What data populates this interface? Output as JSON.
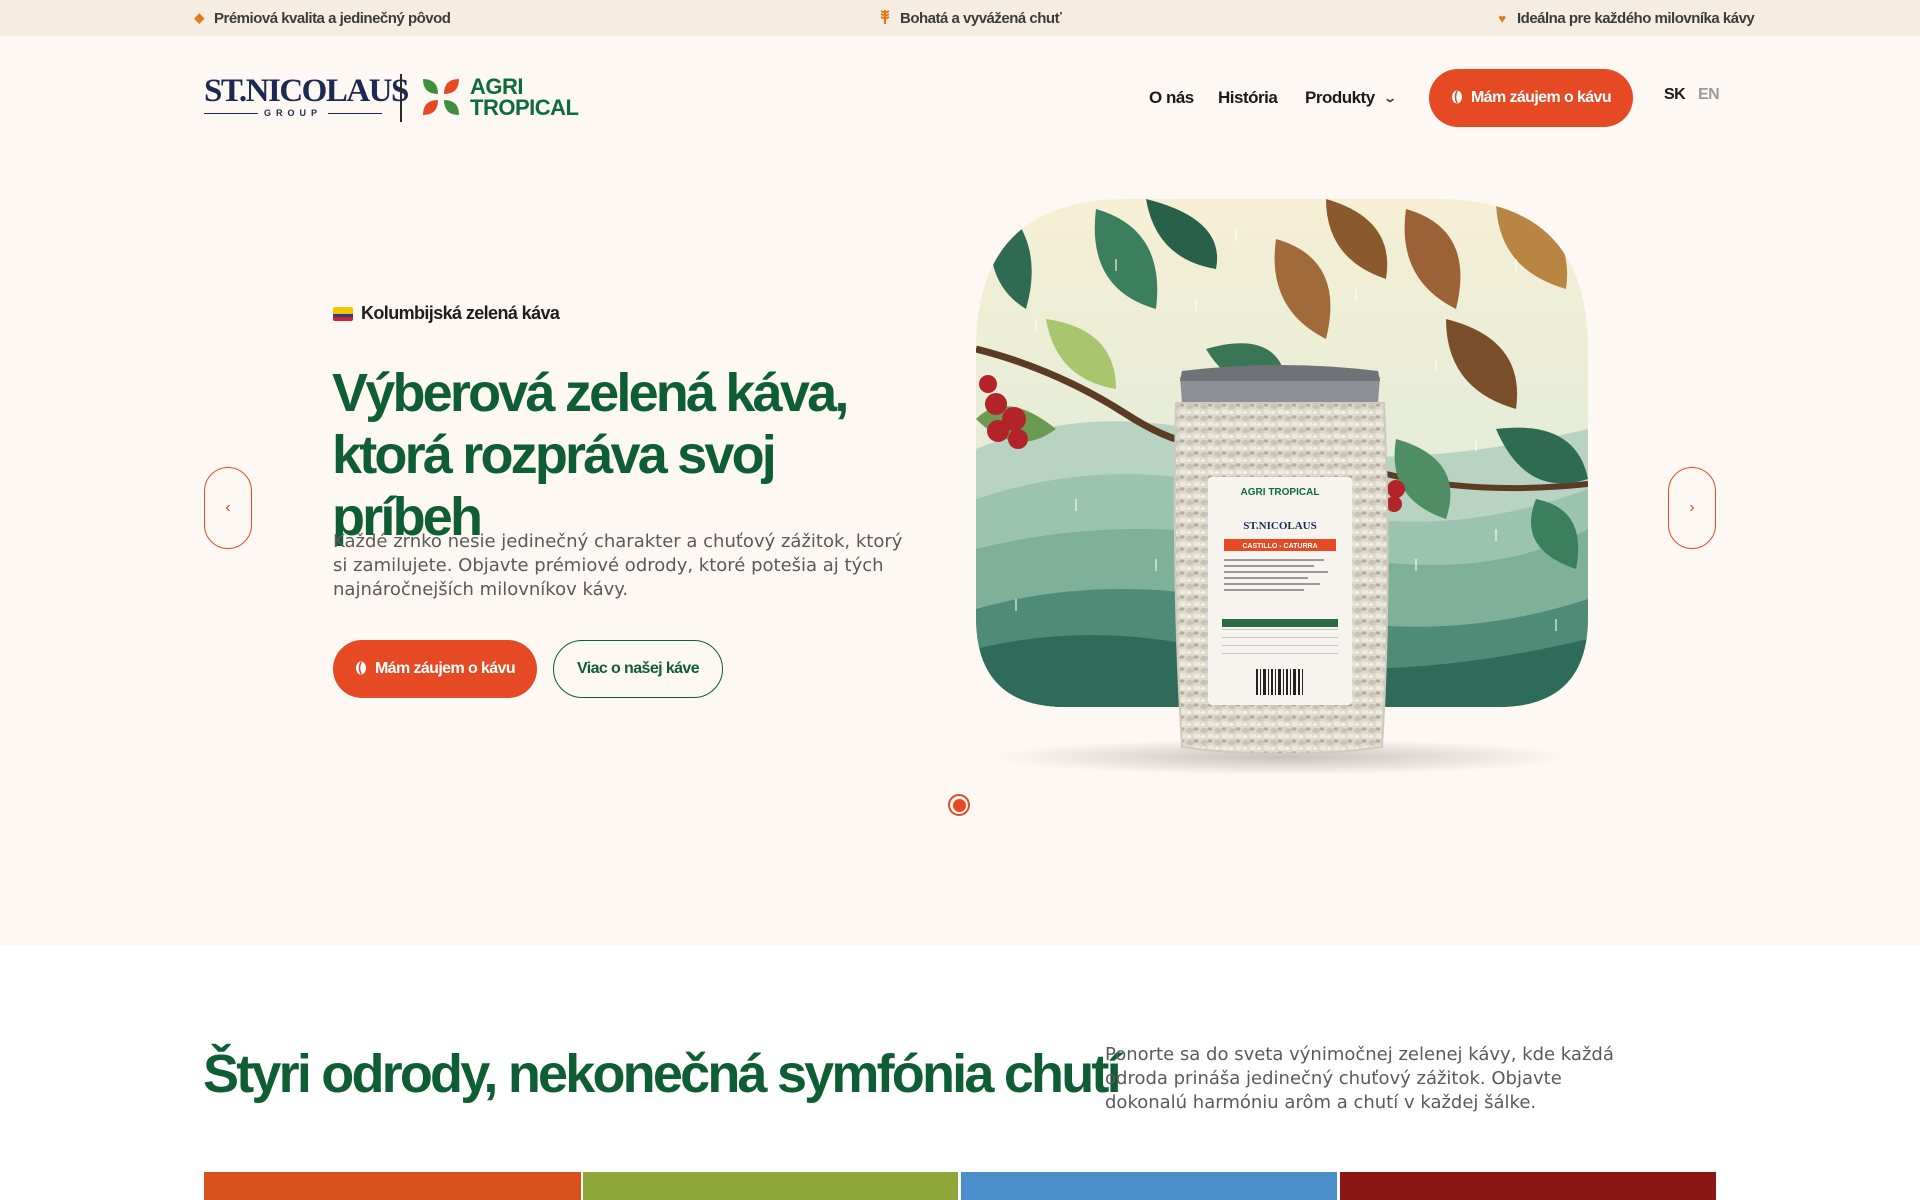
{
  "topbar": {
    "items": [
      {
        "icon": "diamond-icon",
        "text": "Prémiová kvalita a jedinečný pôvod"
      },
      {
        "icon": "wheat-icon",
        "text": "Bohatá a vyvážená chuť"
      },
      {
        "icon": "heart-icon",
        "text": "Ideálna pre každého milovníka kávy"
      }
    ]
  },
  "header": {
    "logo_st": {
      "name": "ST.NICOLAUS",
      "sub": "GROUP"
    },
    "logo_agri": {
      "line1": "AGRI",
      "line2": "TROPICAL"
    },
    "nav": {
      "about": "O nás",
      "history": "História",
      "products": "Produkty"
    },
    "cta": "Mám záujem o kávu",
    "lang": {
      "sk": "SK",
      "en": "EN"
    }
  },
  "hero": {
    "badge": "Kolumbijská zelená káva",
    "title": "Výberová zelená káva, ktorá rozpráva svoj príbeh",
    "description": "Každé zrnko nesie jedinečný charakter a chuťový zážitok, ktorý si zamilujete. Objavte prémiové odrody, ktoré potešia aj tých najnáročnejších milovníkov kávy.",
    "cta_primary": "Mám záujem o kávu",
    "cta_secondary": "Viac o našej káve",
    "prev_arrow": "‹",
    "next_arrow": "›",
    "package_label": {
      "brand": "ST.NICOLAUS",
      "variety": "CASTILLO - CATURRA",
      "agri": "AGRI TROPICAL"
    }
  },
  "varieties": {
    "title": "Štyri odrody, nekonečná symfónia chutí",
    "description": "Ponorte sa do sveta výnimočnej zelenej kávy, kde každá odroda prináša jedinečný chuťový zážitok. Objavte dokonalú harmóniu arôm a chutí v každej šálke."
  },
  "colors": {
    "accent": "#e54a24",
    "brand_green": "#0e5d35",
    "variety_1": "#d8511f",
    "variety_2": "#8ea63a",
    "variety_3": "#4a8fcb",
    "variety_4": "#8b1616"
  }
}
